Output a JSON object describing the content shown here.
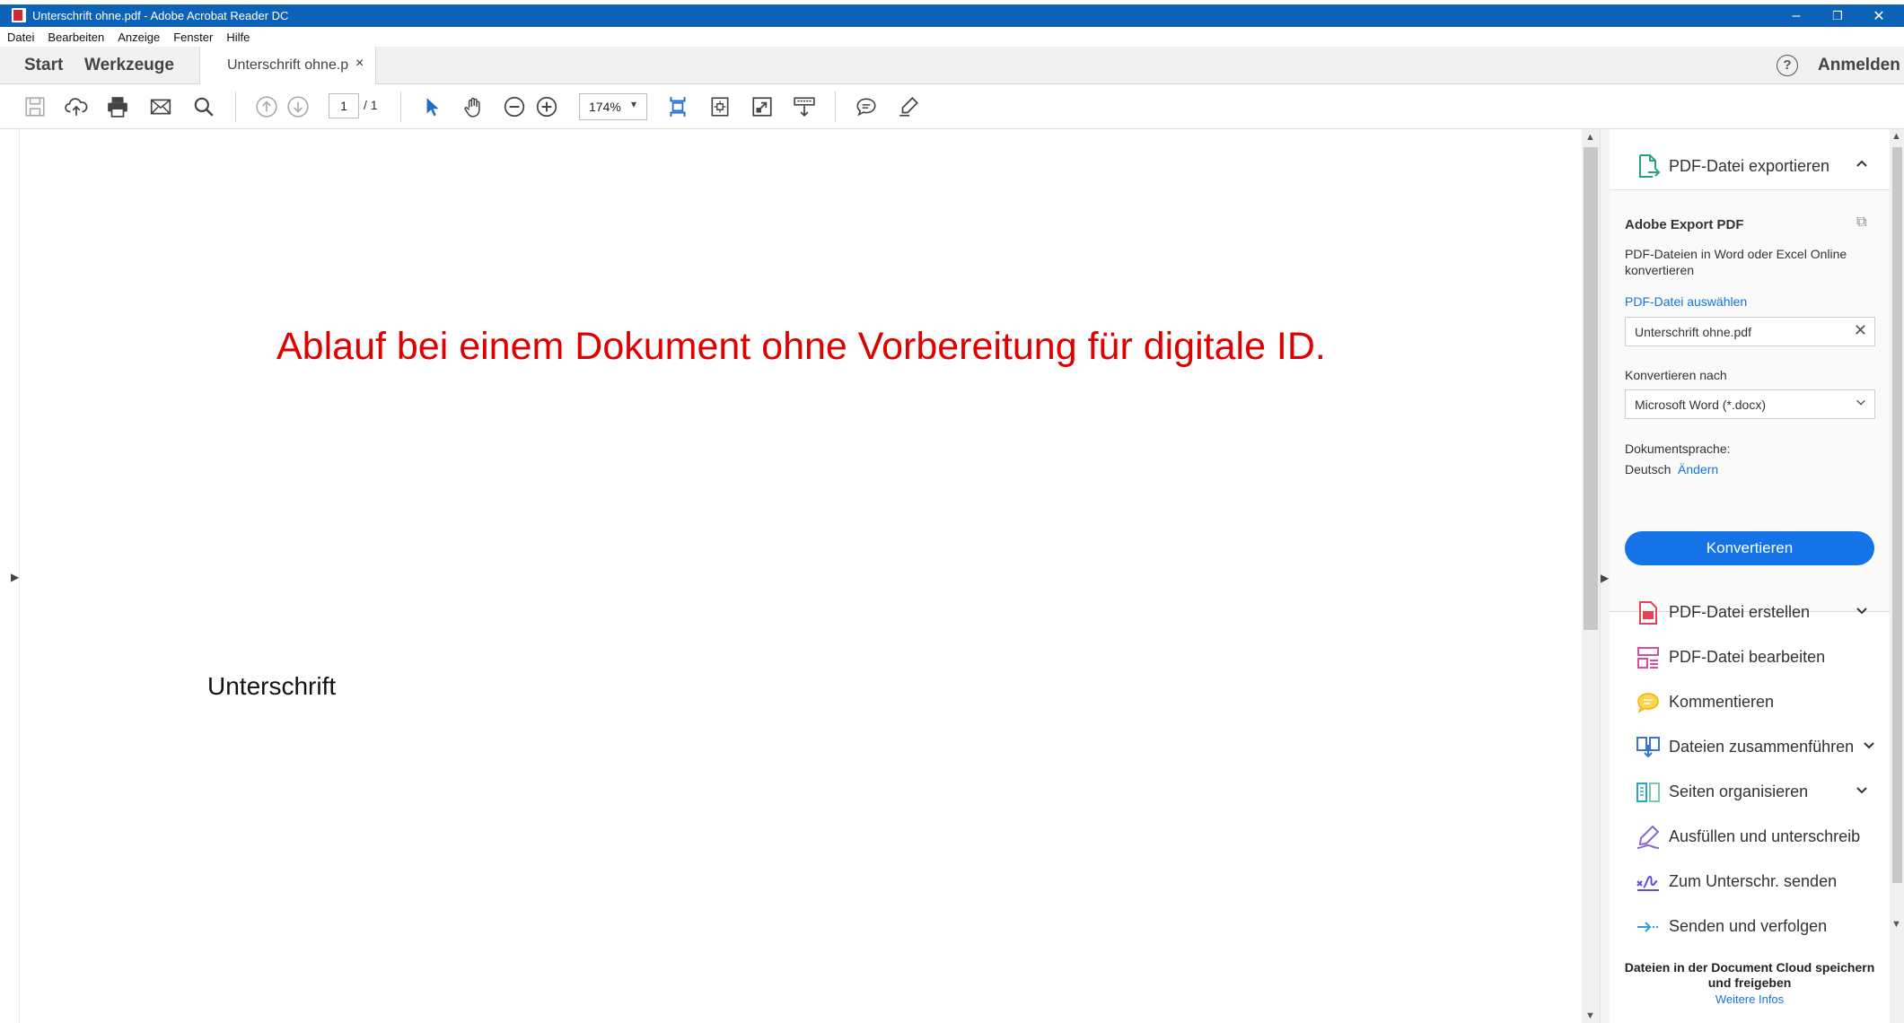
{
  "window": {
    "title": "Unterschrift ohne.pdf - Adobe Acrobat Reader DC",
    "minimize": "–",
    "restore": "❐",
    "close": "✕"
  },
  "menu": [
    "Datei",
    "Bearbeiten",
    "Anzeige",
    "Fenster",
    "Hilfe"
  ],
  "tabs": {
    "start": "Start",
    "tools": "Werkzeuge",
    "document": "Unterschrift ohne.p",
    "close": "×"
  },
  "header": {
    "help": "?",
    "signin": "Anmelden"
  },
  "toolbar": {
    "page_current": "1",
    "page_total": "/ 1",
    "zoom": "174%"
  },
  "document": {
    "heading": "Ablauf bei einem Dokument ohne Vorbereitung für digitale ID.",
    "label": "Unterschrift"
  },
  "export_panel": {
    "title": "PDF-Datei exportieren",
    "section_title": "Adobe Export PDF",
    "description": "PDF-Dateien in Word oder Excel Online konvertieren",
    "select_link": "PDF-Datei auswählen",
    "selected_file": "Unterschrift ohne.pdf",
    "convert_to_label": "Konvertieren nach",
    "convert_to_value": "Microsoft Word (*.docx)",
    "language_label": "Dokumentsprache:",
    "language_value": "Deutsch",
    "change_link": "Ändern",
    "convert_button": "Konvertieren"
  },
  "tools": [
    {
      "label": "PDF-Datei erstellen",
      "icon": "create-pdf-icon",
      "expandable": true
    },
    {
      "label": "PDF-Datei bearbeiten",
      "icon": "edit-pdf-icon",
      "expandable": false
    },
    {
      "label": "Kommentieren",
      "icon": "comment-icon",
      "expandable": false
    },
    {
      "label": "Dateien zusammenführen",
      "icon": "combine-files-icon",
      "expandable": true
    },
    {
      "label": "Seiten organisieren",
      "icon": "organize-pages-icon",
      "expandable": true
    },
    {
      "label": "Ausfüllen und unterschreib",
      "icon": "fill-sign-icon",
      "expandable": false
    },
    {
      "label": "Zum Unterschr. senden",
      "icon": "send-signature-icon",
      "expandable": false
    },
    {
      "label": "Senden und verfolgen",
      "icon": "send-track-icon",
      "expandable": false
    }
  ],
  "cloud": {
    "text": "Dateien in der Document Cloud speichern und freigeben",
    "link": "Weitere Infos"
  },
  "colors": {
    "titlebar": "#0c62b6",
    "accent": "#1473e6",
    "heading": "#e00000"
  }
}
